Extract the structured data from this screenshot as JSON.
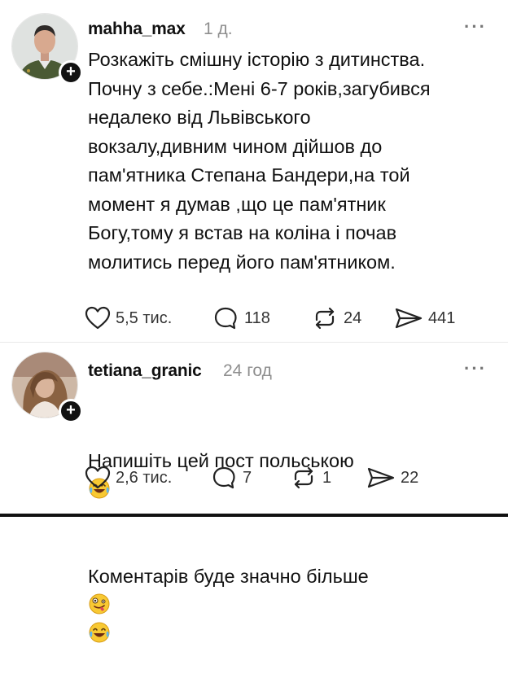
{
  "posts": [
    {
      "username": "mahha_max",
      "time": "1 д.",
      "text": "Розкажіть смішну історію з дитинства.\nПочну з себе.:Мені 6-7 років,загубився\nнедалеко від Львівського\nвокзалу,дивним чином дійшов до\nпам'ятника Степана Бандери,на той\nмомент я думав ,що це пам'ятник\nБогу,тому я встав на коліна і почав\nмолитись перед його пам'ятником.",
      "likes": "5,5 тис.",
      "comments": "118",
      "reposts": "24",
      "shares": "441"
    },
    {
      "username": "tetiana_granic",
      "time": "24 год",
      "line1": "Напишіть цей пост польською",
      "line2": "Коментарів буде значно більше",
      "likes": "2,6 тис.",
      "comments": "7",
      "reposts": "1",
      "shares": "22"
    }
  ],
  "icons": {
    "more": "more-icon",
    "like": "heart-icon",
    "comment": "comment-icon",
    "repost": "repost-icon",
    "share": "share-icon",
    "follow": "plus-icon",
    "emoji_laugh": "tears-of-joy-emoji",
    "emoji_zany": "zany-face-emoji"
  },
  "colors": {
    "text": "#111111",
    "muted": "#8e8e8e",
    "background": "#ffffff"
  }
}
